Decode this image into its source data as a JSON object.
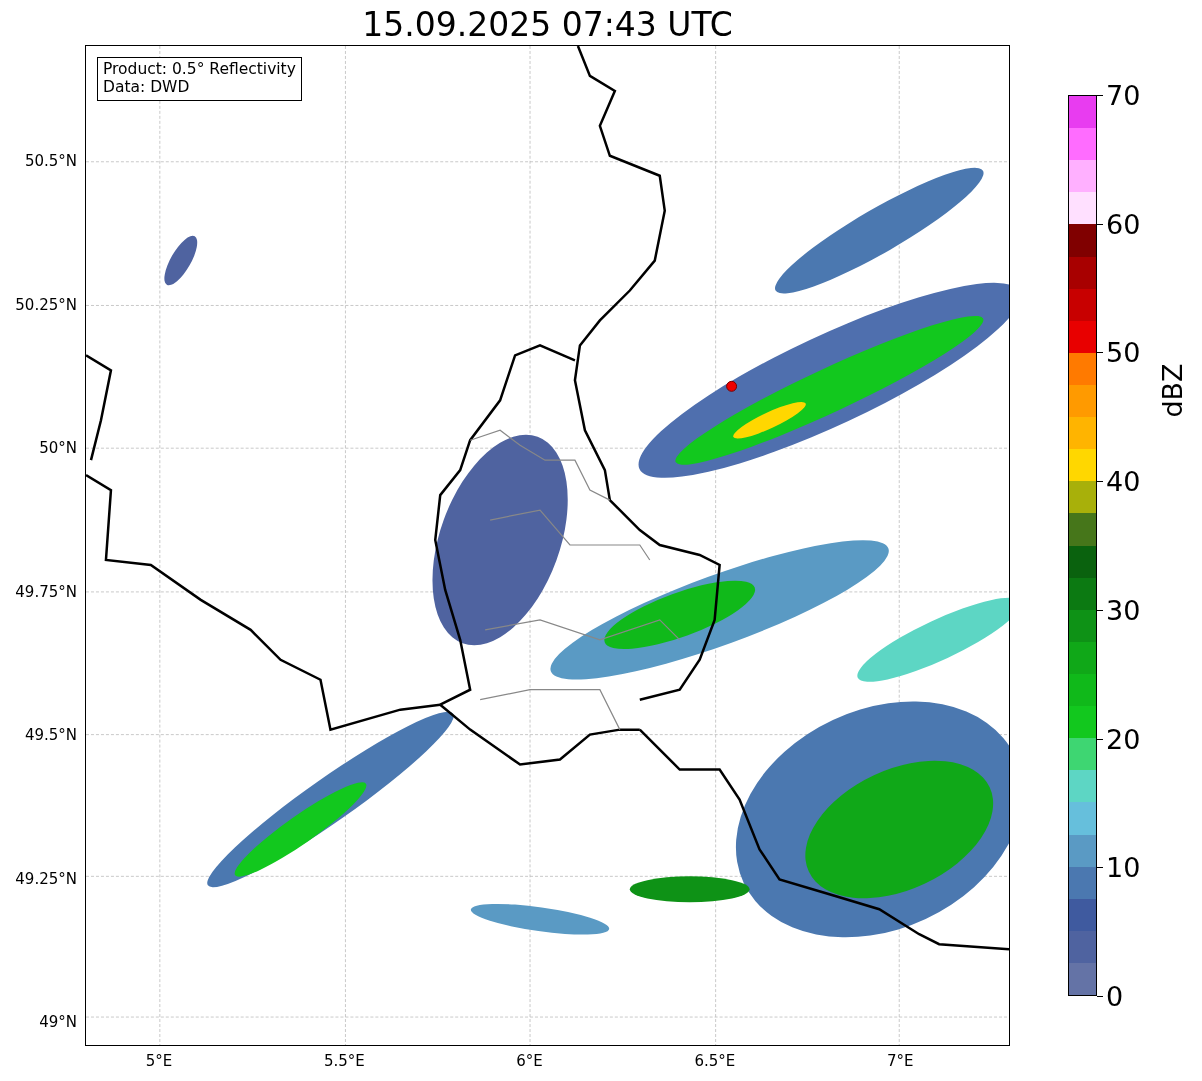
{
  "title": "15.09.2025 07:43 UTC",
  "legend": {
    "lines": [
      "Product: 0.5° Reflectivity",
      "Data: DWD"
    ]
  },
  "map": {
    "xticks": [
      "5°E",
      "5.5°E",
      "6°E",
      "6.5°E",
      "7°E"
    ],
    "yticks": [
      "50.5°N",
      "50.25°N",
      "50°N",
      "49.75°N",
      "49.5°N",
      "49.25°N",
      "49°N"
    ]
  },
  "colorbar": {
    "label": "dBZ",
    "ticks": [
      "70",
      "60",
      "50",
      "40",
      "30",
      "20",
      "10",
      "0"
    ],
    "segments": [
      {
        "color": "#e83cf0"
      },
      {
        "color": "#ff6cff"
      },
      {
        "color": "#ffb0ff"
      },
      {
        "color": "#ffe0ff"
      },
      {
        "color": "#800000"
      },
      {
        "color": "#a80000"
      },
      {
        "color": "#c80000"
      },
      {
        "color": "#e80000"
      },
      {
        "color": "#ff7a00"
      },
      {
        "color": "#ff9a00"
      },
      {
        "color": "#ffb400"
      },
      {
        "color": "#ffd700"
      },
      {
        "color": "#a8b00a"
      },
      {
        "color": "#46761a"
      },
      {
        "color": "#0a620e"
      },
      {
        "color": "#0c7a12"
      },
      {
        "color": "#0e9216"
      },
      {
        "color": "#10a818"
      },
      {
        "color": "#10b91a"
      },
      {
        "color": "#12c81e"
      },
      {
        "color": "#3ed672"
      },
      {
        "color": "#5dd6c4"
      },
      {
        "color": "#66bfdc"
      },
      {
        "color": "#5a9ac4"
      },
      {
        "color": "#4b78b0"
      },
      {
        "color": "#3f5a9f"
      },
      {
        "color": "#4f63a0"
      },
      {
        "color": "#6473a6"
      }
    ]
  }
}
